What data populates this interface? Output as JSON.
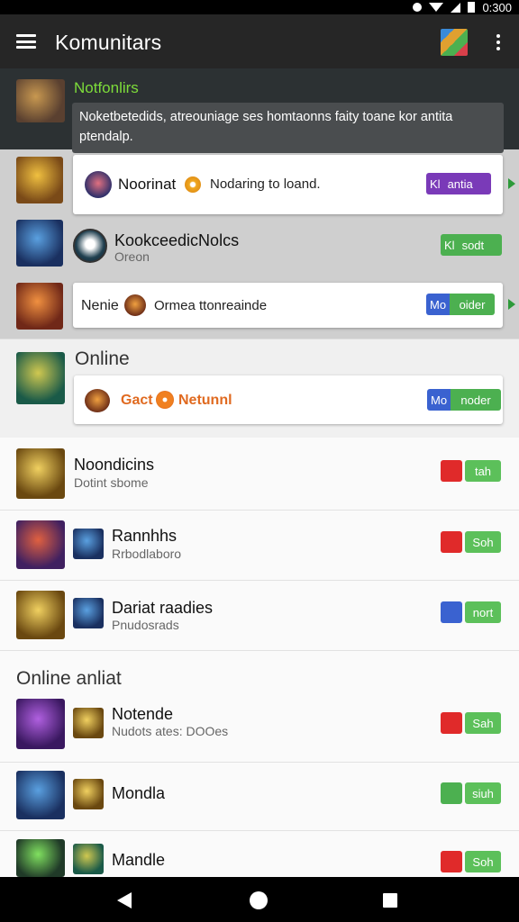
{
  "status_bar": {
    "time": "0:300"
  },
  "header": {
    "title": "Komunitars"
  },
  "featured": {
    "title": "Notfonlirs",
    "tooltip": "Noketbetedids, atreouniage ses homtaonns faity toane kor antita ptendalp."
  },
  "cards": [
    {
      "name": "Noorinat",
      "message": "Nodaring to loand.",
      "button": {
        "icon": "Kl",
        "label": "antia"
      }
    },
    {
      "name": "KookceedicNolcs",
      "sub": "Oreon",
      "button": {
        "icon": "Kl",
        "label": "sodt"
      }
    },
    {
      "name": "Nenie",
      "message": "Ormea ttonreainde",
      "button": {
        "icon": "Mo",
        "label": "oider"
      }
    }
  ],
  "online": {
    "label": "Online",
    "card": {
      "text": "Gact",
      "name": "Netunnl",
      "button": {
        "icon": "Mo",
        "label": "noder"
      }
    }
  },
  "rows": [
    {
      "title": "Noondicins",
      "sub": "Dotint sbome",
      "pill": "tah",
      "icon_color": "red"
    },
    {
      "title": "Rannhhs",
      "sub": "Rrbodlaboro",
      "pill": "Soh",
      "icon_color": "red"
    },
    {
      "title": "Dariat raadies",
      "sub": "Pnudosrads",
      "pill": "nort",
      "icon_color": "blue"
    }
  ],
  "section2": {
    "label": "Online anliat"
  },
  "rows2": [
    {
      "title": "Notende",
      "sub": "Nudots ates: DOOes",
      "pill": "Sah",
      "icon_color": "red"
    },
    {
      "title": "Mondla",
      "sub": "",
      "pill": "siuh",
      "icon_color": "green"
    },
    {
      "title": "Mandle",
      "sub": "",
      "pill": "Soh",
      "icon_color": "red"
    }
  ],
  "colors": {
    "accent_green": "#4cb050",
    "accent_purple": "#7a3ab8",
    "accent_blue": "#3a62d0",
    "accent_red": "#e02a2a",
    "notif_green": "#7ddc3a"
  }
}
